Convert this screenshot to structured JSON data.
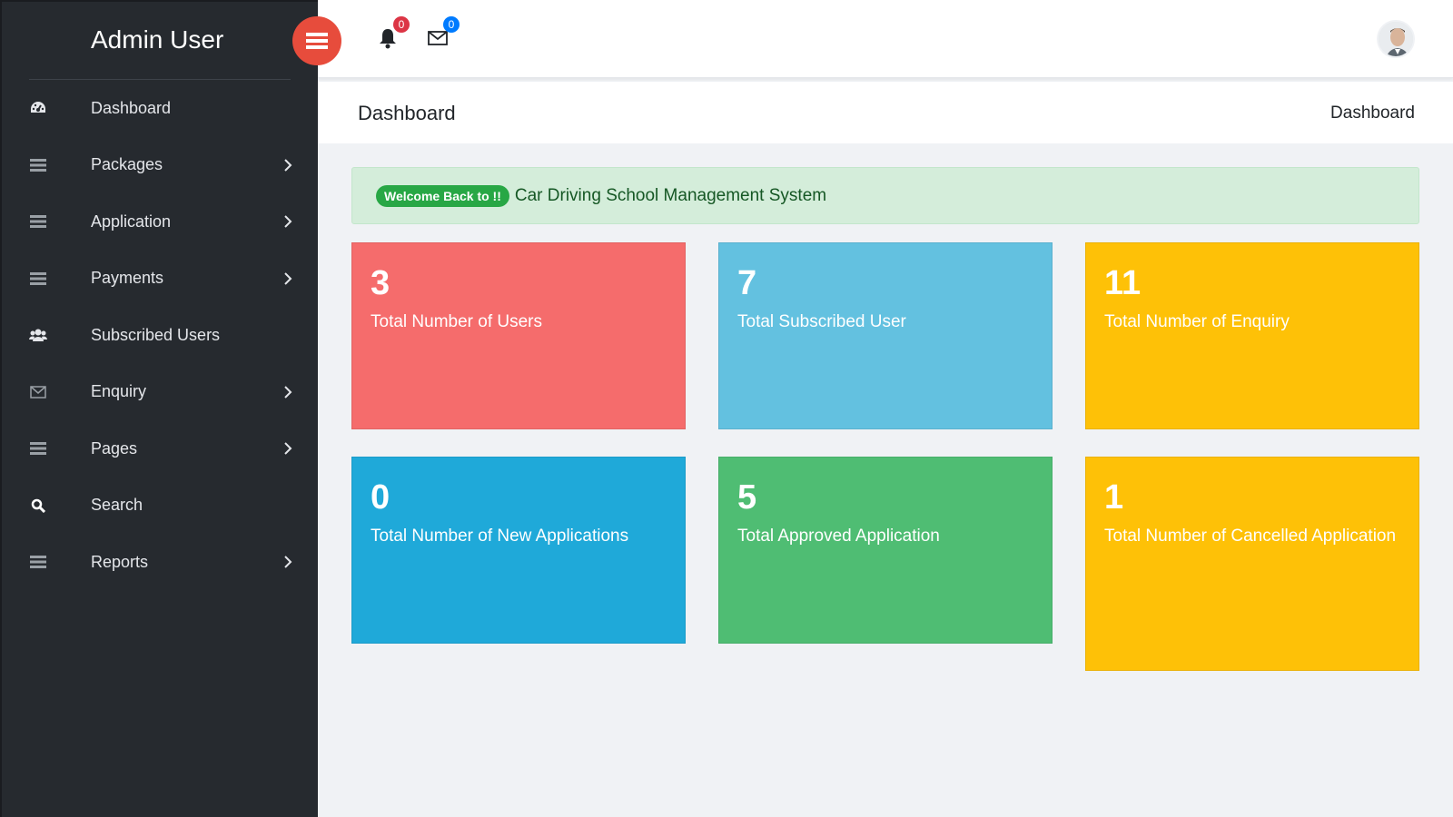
{
  "sidebar": {
    "brand": "Admin User",
    "items": [
      {
        "label": "Dashboard",
        "icon": "dashboard-icon",
        "has_submenu": false
      },
      {
        "label": "Packages",
        "icon": "list-icon",
        "has_submenu": true
      },
      {
        "label": "Application",
        "icon": "list-icon",
        "has_submenu": true
      },
      {
        "label": "Payments",
        "icon": "list-icon",
        "has_submenu": true
      },
      {
        "label": "Subscribed Users",
        "icon": "users-icon",
        "has_submenu": false
      },
      {
        "label": "Enquiry",
        "icon": "envelope-icon",
        "has_submenu": true
      },
      {
        "label": "Pages",
        "icon": "list-icon",
        "has_submenu": true
      },
      {
        "label": "Search",
        "icon": "search-icon",
        "has_submenu": false
      },
      {
        "label": "Reports",
        "icon": "list-icon",
        "has_submenu": true
      }
    ]
  },
  "topbar": {
    "notifications_count": "0",
    "messages_count": "0"
  },
  "page": {
    "title": "Dashboard",
    "breadcrumb": "Dashboard"
  },
  "alert": {
    "badge": "Welcome Back to !!",
    "text": "Car Driving School Management System"
  },
  "cards": [
    {
      "value": "3",
      "label": "Total Number of Users",
      "color": "#f56c6c"
    },
    {
      "value": "7",
      "label": "Total Subscribed User",
      "color": "#63c1e0"
    },
    {
      "value": "11",
      "label": "Total Number of Enquiry",
      "color": "#fec107"
    },
    {
      "value": "0",
      "label": "Total Number of New Applications",
      "color": "#1fa9d9"
    },
    {
      "value": "5",
      "label": "Total Approved Application",
      "color": "#4fbd73"
    },
    {
      "value": "1",
      "label": "Total Number of Cancelled Application",
      "color": "#fec107"
    }
  ],
  "colors": {
    "sidebar_bg": "#262a2f",
    "toggle": "#e74c3c",
    "badge_red": "#dc3545",
    "badge_blue": "#007bff",
    "success": "#28a745"
  }
}
